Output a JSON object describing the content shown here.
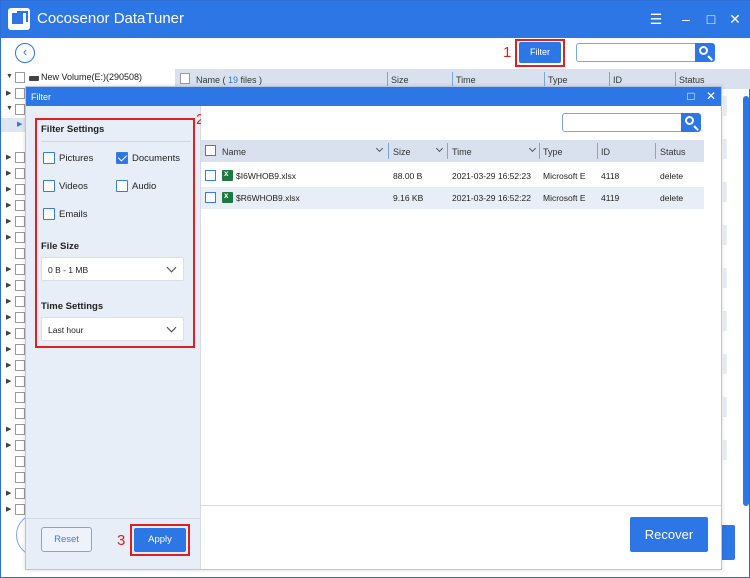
{
  "app": {
    "title": "Cocosenor DataTuner",
    "window_controls": [
      "menu-icon",
      "minimize-icon",
      "maximize-icon",
      "close-icon"
    ]
  },
  "toolbar": {
    "back_icon": "chevron-left-icon",
    "filter_label": "Filter",
    "step1": "1",
    "search_value": "",
    "search_icon": "search-icon"
  },
  "tree": {
    "root_label": "New Volume(E:)(290508)"
  },
  "background_table": {
    "name_header_prefix": "Name ( ",
    "file_count": "19",
    "name_header_suffix": " files )",
    "columns": [
      "Size",
      "Time",
      "Type",
      "ID",
      "Status"
    ]
  },
  "dialog": {
    "title": "Filter",
    "step2": "2",
    "step3": "3",
    "filter_settings_title": "Filter Settings",
    "categories": [
      {
        "label": "Pictures",
        "checked": false
      },
      {
        "label": "Documents",
        "checked": true
      },
      {
        "label": "Videos",
        "checked": false
      },
      {
        "label": "Audio",
        "checked": false
      },
      {
        "label": "Emails",
        "checked": false
      }
    ],
    "file_size_label": "File Size",
    "file_size_value": "0 B - 1 MB",
    "time_settings_label": "Time Settings",
    "time_settings_value": "Last hour",
    "reset_label": "Reset",
    "apply_label": "Apply",
    "search_value": "",
    "table": {
      "columns": [
        "Name",
        "Size",
        "Time",
        "Type",
        "ID",
        "Status"
      ],
      "rows": [
        {
          "name": "$I6WHOB9.xlsx",
          "size": "88.00 B",
          "time": "2021-03-29 16:52:23",
          "type": "Microsoft E",
          "id": "4118",
          "status": "delete"
        },
        {
          "name": "$R6WHOB9.xlsx",
          "size": "9.16 KB",
          "time": "2021-03-29 16:52:22",
          "type": "Microsoft E",
          "id": "4119",
          "status": "delete"
        }
      ]
    },
    "recover_label": "Recover"
  },
  "colors": {
    "accent": "#2d76e6",
    "annotation": "#e02020",
    "panel": "#e8eef7",
    "header": "#d9e1ef"
  }
}
